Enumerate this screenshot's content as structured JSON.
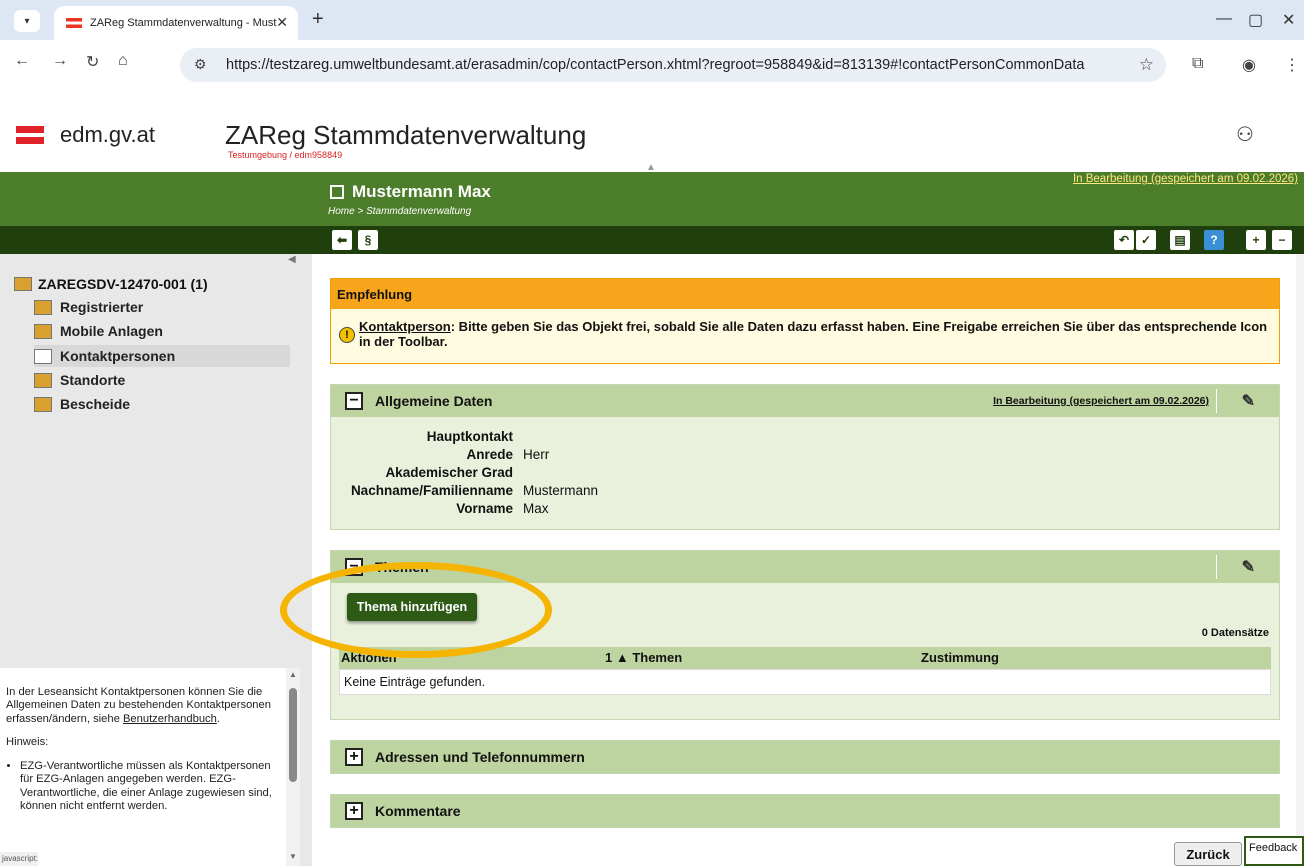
{
  "browser": {
    "tab_title": "ZAReg Stammdatenverwaltung - Must",
    "url": "https://testzareg.umweltbundesamt.at/erasadmin/cop/contactPerson.xhtml?regroot=958849&id=813139#!contactPersonCommonData"
  },
  "header": {
    "logo_text": "edm.gv.at",
    "app_title": "ZAReg Stammdatenverwaltung",
    "env_label": "Testumgebung / edm958849"
  },
  "page": {
    "title": "Mustermann Max",
    "breadcrumb": "Home > Stammdatenverwaltung",
    "status": "In Bearbeitung (gespeichert am 09.02.2026)"
  },
  "sidebar": {
    "root": "ZAREGSDV-12470-001 (1)",
    "items": [
      {
        "label": "Registrierter"
      },
      {
        "label": "Mobile Anlagen"
      },
      {
        "label": "Kontaktpersonen"
      },
      {
        "label": "Standorte"
      },
      {
        "label": "Bescheide"
      }
    ]
  },
  "help": {
    "p1_pre": "In der Leseansicht Kontaktpersonen können Sie die Allgemeinen Daten zu bestehenden Kontaktpersonen erfassen/ändern, siehe ",
    "p1_link": "Benutzerhandbuch",
    "p1_post": ".",
    "hint": "Hinweis:",
    "bullet": "EZG-Verantwortliche müssen als Kontaktpersonen für EZG-Anlagen angegeben werden. EZG-Verantwortliche, die einer Anlage zugewiesen sind, können nicht entfernt werden."
  },
  "js_badge": "javascript:",
  "empfehlung": {
    "title": "Empfehlung",
    "link": "Kontaktperson",
    "text": ": Bitte geben Sie das Objekt frei, sobald Sie alle Daten dazu erfasst haben. Eine Freigabe erreichen Sie über das entsprechende Icon in der Toolbar."
  },
  "allgemein": {
    "title": "Allgemeine Daten",
    "status": "In Bearbeitung (gespeichert am 09.02.2026)",
    "fields": [
      {
        "k": "Hauptkontakt",
        "v": ""
      },
      {
        "k": "Anrede",
        "v": "Herr"
      },
      {
        "k": "Akademischer Grad",
        "v": ""
      },
      {
        "k": "Nachname/Familienname",
        "v": "Mustermann"
      },
      {
        "k": "Vorname",
        "v": "Max"
      }
    ]
  },
  "themen": {
    "title": "Themen",
    "add_button": "Thema hinzufügen",
    "count": "0 Datensätze",
    "columns": [
      "Aktionen",
      "1 ▲ Themen",
      "Zustimmung"
    ],
    "empty": "Keine Einträge gefunden."
  },
  "adressen": {
    "title": "Adressen und Telefonnummern"
  },
  "kommentare": {
    "title": "Kommentare"
  },
  "footer": {
    "back": "Zurück",
    "feedback": "Feedback"
  },
  "colors": {
    "green": "#4c7d2a",
    "dark_green": "#1f3f0c",
    "orange": "#f7a51a",
    "highlight": "#f5b400"
  }
}
